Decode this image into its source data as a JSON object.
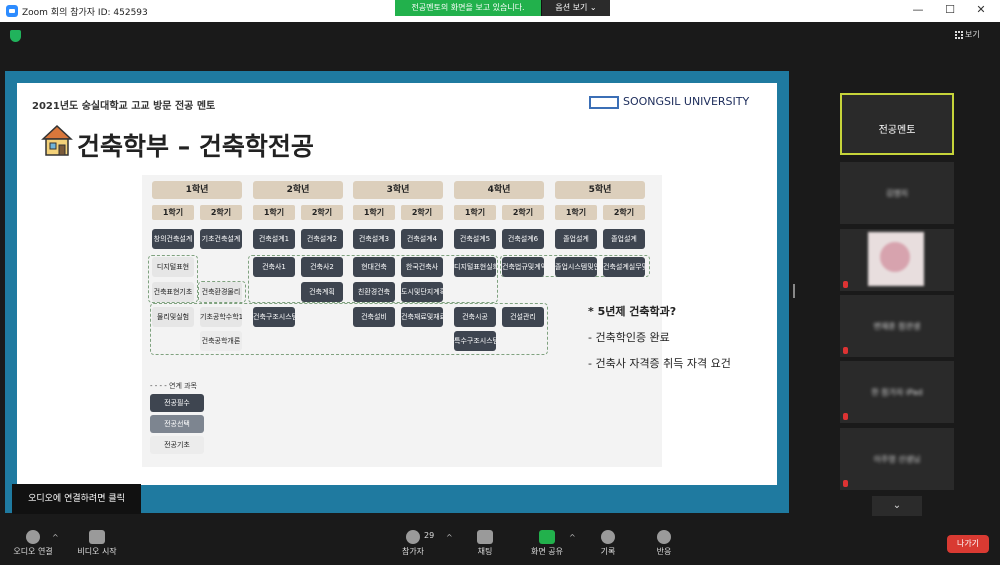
{
  "window": {
    "title": "Zoom 회의 참가자 ID: 452593",
    "controls": [
      "—",
      "☐",
      "✕"
    ]
  },
  "share_banner": {
    "text": "전공멘토의 화면을 보고 있습니다.",
    "options_label": "옵션 보기 ⌄"
  },
  "view_button": {
    "label": "보기"
  },
  "slide": {
    "subtitle": "2021년도 숭실대학교 고교 방문 전공 멘토",
    "university": "SOONGSIL UNIVERSITY",
    "title": "건축학부 – 건축학전공",
    "years": [
      "1학년",
      "2학년",
      "3학년",
      "4학년",
      "5학년"
    ],
    "semesters": [
      "1학기",
      "2학기",
      "1학기",
      "2학기",
      "1학기",
      "2학기",
      "1학기",
      "2학기",
      "1학기",
      "2학기"
    ],
    "courses": [
      "창의건축설계",
      "기초건축설계",
      "건축설계1",
      "건축설계2",
      "건축설계3",
      "건축설계4",
      "건축설계5",
      "건축설계6",
      "졸업설계",
      "졸업설계",
      "디지털표현",
      "건축사1",
      "건축사2",
      "현대건축",
      "한국건축사",
      "디지털표현실화",
      "건축법규및계약",
      "졸업시스템및안전",
      "건축설계실무및경영",
      "건축표현기초",
      "건축환경물리",
      "건축계획",
      "친환경건축",
      "도시및단지계획",
      "물리및실험",
      "기초공학수학1",
      "건축구조시스템",
      "건축설비",
      "건축재료및재료",
      "건축시공",
      "건설관리",
      "건축공학개론",
      "특수구조시스템설계론"
    ],
    "legend": {
      "caption": "연계 과목",
      "required": "전공필수",
      "elective": "전공선택",
      "basic": "전공기초"
    },
    "notes": [
      "* 5년제 건축학과?",
      "-    건축학인증 완료",
      "-    건축사 자격증 취득 자격 요건"
    ]
  },
  "tooltip": "오디오에 연결하려면 클릭",
  "toolbar": {
    "audio": "오디오 연결",
    "video": "비디오 시작",
    "participants": "참가자",
    "participants_count": "29",
    "chat": "채팅",
    "share": "화면 공유",
    "record": "기록",
    "reactions": "반응",
    "leave": "나가기"
  },
  "participants": {
    "active": "전공멘토",
    "others": [
      "김명지",
      "",
      "변재훈 참관생",
      "한 참가자 iPad",
      "이주영 선생님"
    ]
  },
  "colors": {
    "share_green": "#22b14c",
    "leave_red": "#d93a32",
    "active_border": "#c6d43a",
    "slide_frame": "#1f7aa0"
  }
}
